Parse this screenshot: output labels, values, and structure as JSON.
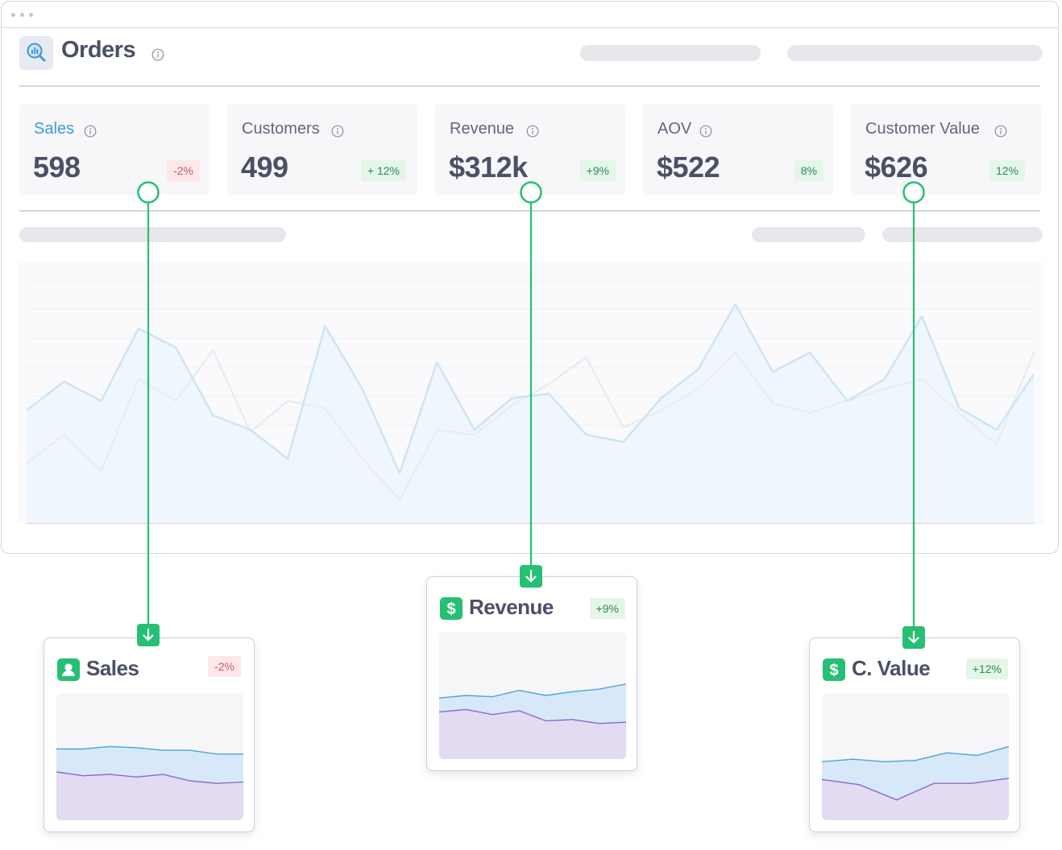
{
  "header": {
    "title": "Orders",
    "icon": "chart-search-icon"
  },
  "kpis": [
    {
      "label": "Sales",
      "value": "598",
      "change": "-2%",
      "trend": "negative",
      "active": true
    },
    {
      "label": "Customers",
      "value": "499",
      "change": "+ 12%",
      "trend": "positive",
      "active": false
    },
    {
      "label": "Revenue",
      "value": "$312k",
      "change": "+9%",
      "trend": "positive",
      "active": false
    },
    {
      "label": "AOV",
      "value": "$522",
      "change": "8%",
      "trend": "positive",
      "active": false
    },
    {
      "label": "Customer Value",
      "value": "$626",
      "change": "12%",
      "trend": "positive",
      "active": false
    }
  ],
  "cards": [
    {
      "title": "Sales",
      "change": "-2%",
      "trend": "negative",
      "icon": "user-icon"
    },
    {
      "title": "Revenue",
      "change": "+9%",
      "trend": "positive",
      "icon": "dollar-icon"
    },
    {
      "title": "C. Value",
      "change": "+12%",
      "trend": "positive",
      "icon": "dollar-icon"
    }
  ],
  "colors": {
    "accent_blue": "#3d9ad8",
    "connector_green": "#27bf73",
    "negative_bg": "#fde7e8",
    "positive_bg": "#e3f6e8"
  },
  "chart_data": [
    {
      "type": "line",
      "title": "",
      "series": [
        {
          "values": [
            46,
            58,
            50,
            80,
            72,
            44,
            38,
            26,
            81,
            55,
            20,
            66,
            38,
            51,
            53,
            36,
            33,
            51,
            63,
            90,
            62,
            70,
            50,
            59,
            85,
            47,
            38,
            61
          ]
        },
        {
          "values": [
            24,
            36,
            21,
            59,
            50,
            71,
            37,
            50,
            47,
            26,
            9,
            38,
            36,
            48,
            57,
            68,
            39,
            46,
            55,
            70,
            49,
            45,
            50,
            55,
            59,
            45,
            32,
            70
          ]
        }
      ],
      "grid": true
    },
    {
      "type": "area",
      "series": [
        {
          "values": [
            56,
            56,
            58,
            57,
            55,
            55,
            52,
            52
          ]
        },
        {
          "values": [
            38,
            35,
            36,
            34,
            36,
            31,
            29,
            30
          ]
        }
      ]
    },
    {
      "type": "area",
      "series": [
        {
          "values": [
            48,
            50,
            49,
            54,
            50,
            53,
            55,
            59
          ]
        },
        {
          "values": [
            37,
            39,
            35,
            38,
            30,
            31,
            28,
            29
          ]
        }
      ]
    },
    {
      "type": "area",
      "series": [
        {
          "values": [
            46,
            48,
            46,
            47,
            53,
            51,
            58
          ]
        },
        {
          "values": [
            32,
            28,
            16,
            29,
            29,
            33
          ]
        }
      ]
    }
  ]
}
